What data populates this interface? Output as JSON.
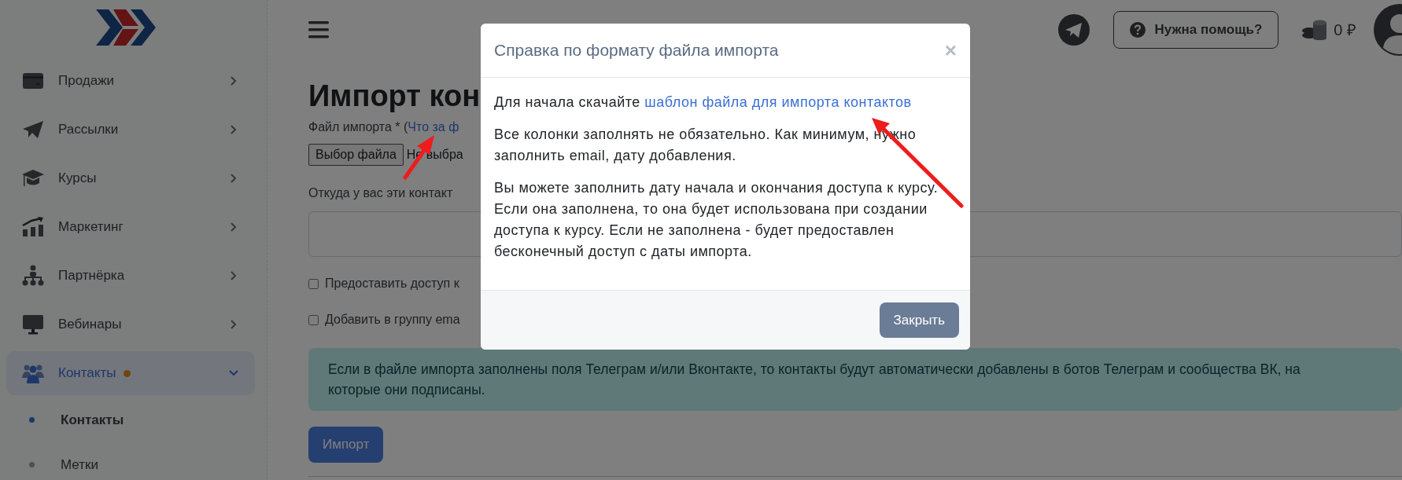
{
  "sidebar": {
    "items": [
      {
        "label": "Продажи",
        "selected": false,
        "expanded": false,
        "dot": false
      },
      {
        "label": "Рассылки",
        "selected": false,
        "expanded": false,
        "dot": false
      },
      {
        "label": "Курсы",
        "selected": false,
        "expanded": false,
        "dot": false
      },
      {
        "label": "Маркетинг",
        "selected": false,
        "expanded": false,
        "dot": false
      },
      {
        "label": "Партнёрка",
        "selected": false,
        "expanded": false,
        "dot": false
      },
      {
        "label": "Вебинары",
        "selected": false,
        "expanded": false,
        "dot": false
      },
      {
        "label": "Контакты",
        "selected": true,
        "expanded": true,
        "dot": true,
        "children": [
          {
            "label": "Контакты",
            "selected": true
          },
          {
            "label": "Метки",
            "selected": false
          }
        ]
      }
    ]
  },
  "header": {
    "help_button": "Нужна помощь?",
    "balance": "0 ₽"
  },
  "page": {
    "title": "Импорт кон",
    "file_label": "Файл импорта * (",
    "file_link": "Что за ф",
    "choose_button": "Выбор файла",
    "file_status": "Не выбра",
    "source_label": "Откуда у вас эти контакт",
    "checkboxes": [
      {
        "label": "Предоставить доступ к",
        "checked": false
      },
      {
        "label": "Добавить в группу ema",
        "checked": false
      }
    ],
    "alert": "Если в файле импорта заполнены поля Телеграм и/или Вконтакте, то контакты будут автоматически добавлены в ботов Телеграм и сообщества ВК, на которые они подписаны.",
    "import_button": "Импорт"
  },
  "modal": {
    "title": "Справка по формату файла импорта",
    "close": "×",
    "intro": "Для начала скачайте ",
    "intro_link": "шаблон файла для импорта контактов",
    "paragraphs": [
      "Все колонки заполнять не обязательно. Как минимум, нужно заполнить email, дату добавления.",
      "Вы можете заполнить дату начала и окончания доступа к курсу. Если она заполнена, то она будет использована при создании доступа к курсу. Если не заполнена - будет предоставлен бесконечный доступ с даты импорта."
    ],
    "button": "Закрыть"
  }
}
